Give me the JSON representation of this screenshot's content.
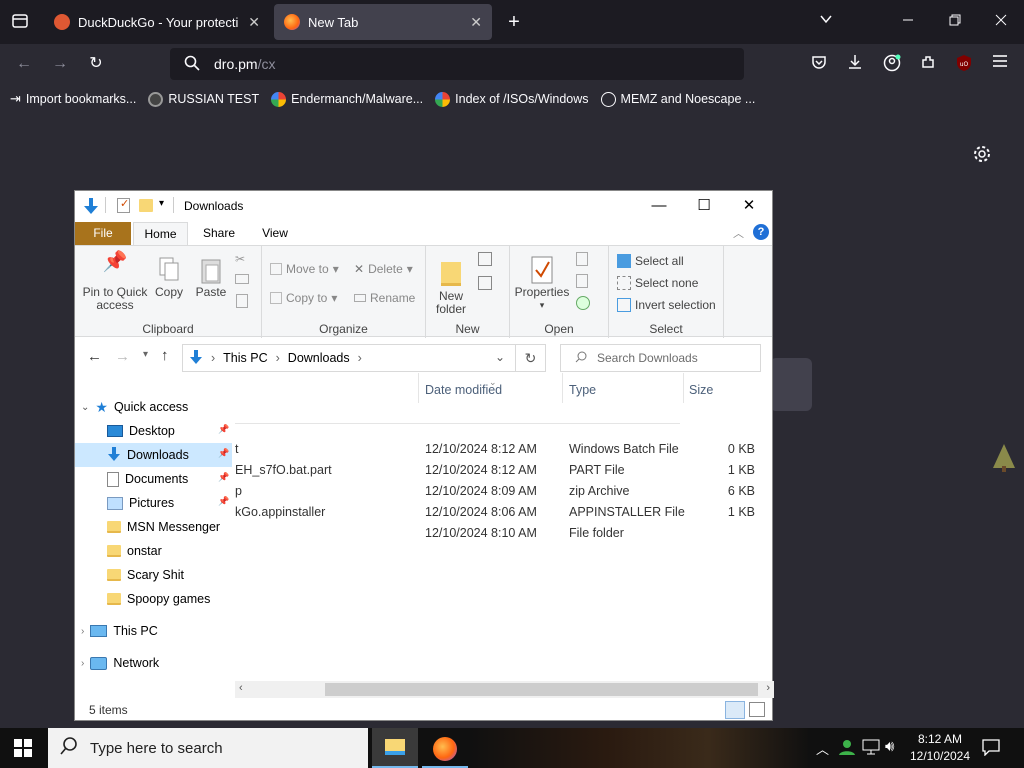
{
  "browser": {
    "tabs": [
      {
        "title": "DuckDuckGo - Your protection,",
        "active": false
      },
      {
        "title": "New Tab",
        "active": true
      }
    ],
    "url": "dro.pm/cx",
    "url_host": "dro.pm",
    "url_path": "/cx",
    "bookmarks": [
      {
        "label": "Import bookmarks...",
        "icon": "import-icon"
      },
      {
        "label": "RUSSIAN TEST",
        "icon": "site-icon"
      },
      {
        "label": "Endermanch/Malware...",
        "icon": "google-icon"
      },
      {
        "label": "Index of /ISOs/Windows",
        "icon": "google-icon"
      },
      {
        "label": "MEMZ and Noescape ...",
        "icon": "globe-icon"
      }
    ]
  },
  "explorer": {
    "title": "Downloads",
    "ribbon_tabs": [
      "File",
      "Home",
      "Share",
      "View"
    ],
    "clipboard": {
      "pin": "Pin to Quick access",
      "copy": "Copy",
      "paste": "Paste",
      "label": "Clipboard"
    },
    "organize": {
      "move_to": "Move to",
      "copy_to": "Copy to",
      "delete": "Delete",
      "rename": "Rename",
      "label": "Organize"
    },
    "new": {
      "new_folder": "New folder",
      "label": "New"
    },
    "open": {
      "properties": "Properties",
      "label": "Open"
    },
    "select": {
      "select_all": "Select all",
      "select_none": "Select none",
      "invert": "Invert selection",
      "label": "Select"
    },
    "address": {
      "crumbs": [
        "This PC",
        "Downloads"
      ]
    },
    "search_placeholder": "Search Downloads",
    "columns": {
      "date": "Date modified",
      "type": "Type",
      "size": "Size"
    },
    "nav": {
      "quick_access": "Quick access",
      "items": [
        {
          "label": "Desktop",
          "pinned": true
        },
        {
          "label": "Downloads",
          "pinned": true
        },
        {
          "label": "Documents",
          "pinned": true
        },
        {
          "label": "Pictures",
          "pinned": true
        },
        {
          "label": "MSN Messenger",
          "pinned": false
        },
        {
          "label": "onstar",
          "pinned": false
        },
        {
          "label": "Scary Shit",
          "pinned": false
        },
        {
          "label": "Spoopy games",
          "pinned": false
        }
      ],
      "this_pc": "This PC",
      "network": "Network"
    },
    "files": [
      {
        "name": "t",
        "date": "12/10/2024 8:12 AM",
        "type": "Windows Batch File",
        "size": "0 KB"
      },
      {
        "name": "EH_s7fO.bat.part",
        "date": "12/10/2024 8:12 AM",
        "type": "PART File",
        "size": "1 KB"
      },
      {
        "name": "p",
        "date": "12/10/2024 8:09 AM",
        "type": "zip Archive",
        "size": "6 KB"
      },
      {
        "name": "kGo.appinstaller",
        "date": "12/10/2024 8:06 AM",
        "type": "APPINSTALLER File",
        "size": "1 KB"
      },
      {
        "name": "",
        "date": "12/10/2024 8:10 AM",
        "type": "File folder",
        "size": ""
      }
    ],
    "status": "5 items"
  },
  "taskbar": {
    "search_placeholder": "Type here to search",
    "time": "8:12 AM",
    "date": "12/10/2024"
  }
}
